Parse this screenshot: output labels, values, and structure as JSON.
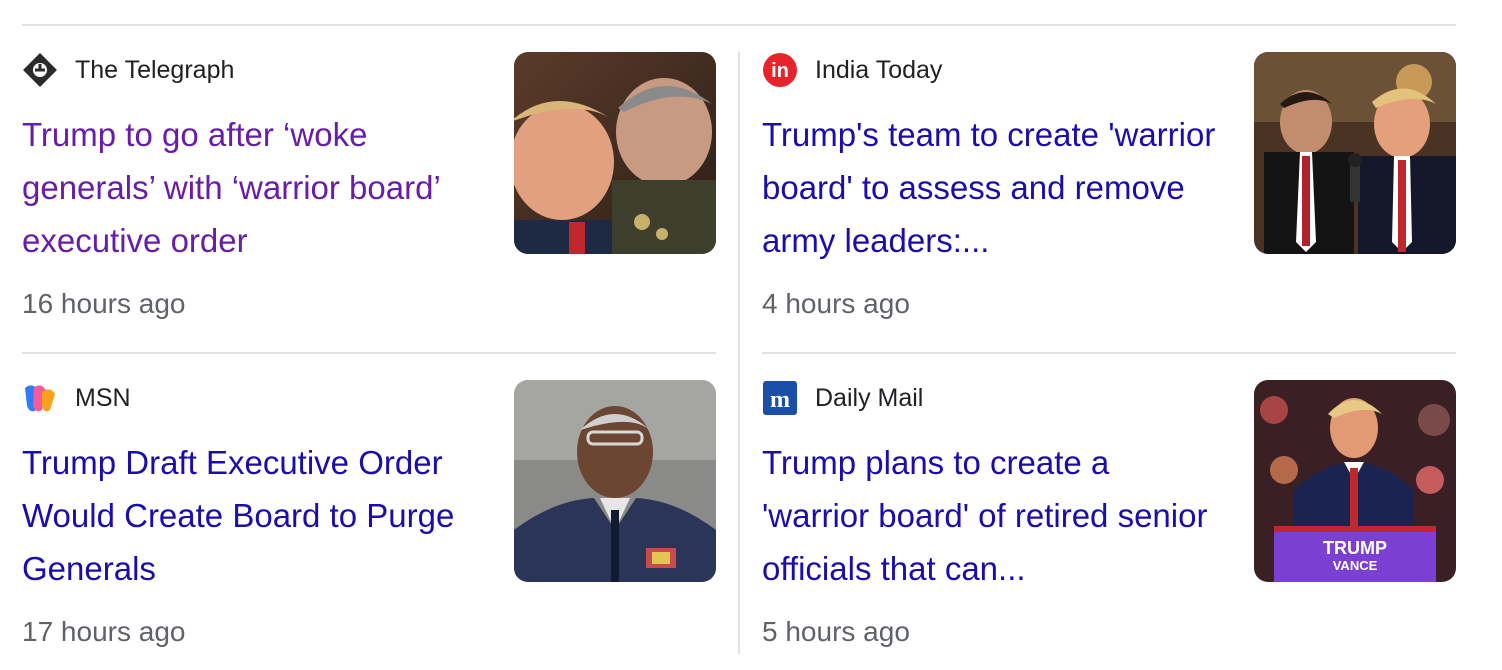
{
  "articles": [
    {
      "source": "The Telegraph",
      "title": "Trump to go after ‘woke generals’ with ‘warrior board’ executive order",
      "time": "16 hours ago",
      "visited": true,
      "icon": "telegraph-logo-icon"
    },
    {
      "source": "India Today",
      "title": "Trump's team to create 'warrior board' to assess and remove army leaders:...",
      "time": "4 hours ago",
      "visited": false,
      "icon": "india-today-logo-icon"
    },
    {
      "source": "MSN",
      "title": "Trump Draft Executive Order Would Create Board to Purge Generals",
      "time": "17 hours ago",
      "visited": false,
      "icon": "msn-logo-icon"
    },
    {
      "source": "Daily Mail",
      "title": "Trump plans to create a 'warrior board' of retired senior officials that can...",
      "time": "5 hours ago",
      "visited": false,
      "icon": "daily-mail-logo-icon"
    }
  ],
  "colors": {
    "link": "#1a0dab",
    "visited_link": "#681da8",
    "meta": "#5f6368",
    "divider": "#e3e3e3"
  },
  "thumb_texts": {
    "sign_line1": "TRUMP",
    "sign_line2": "VANCE"
  }
}
